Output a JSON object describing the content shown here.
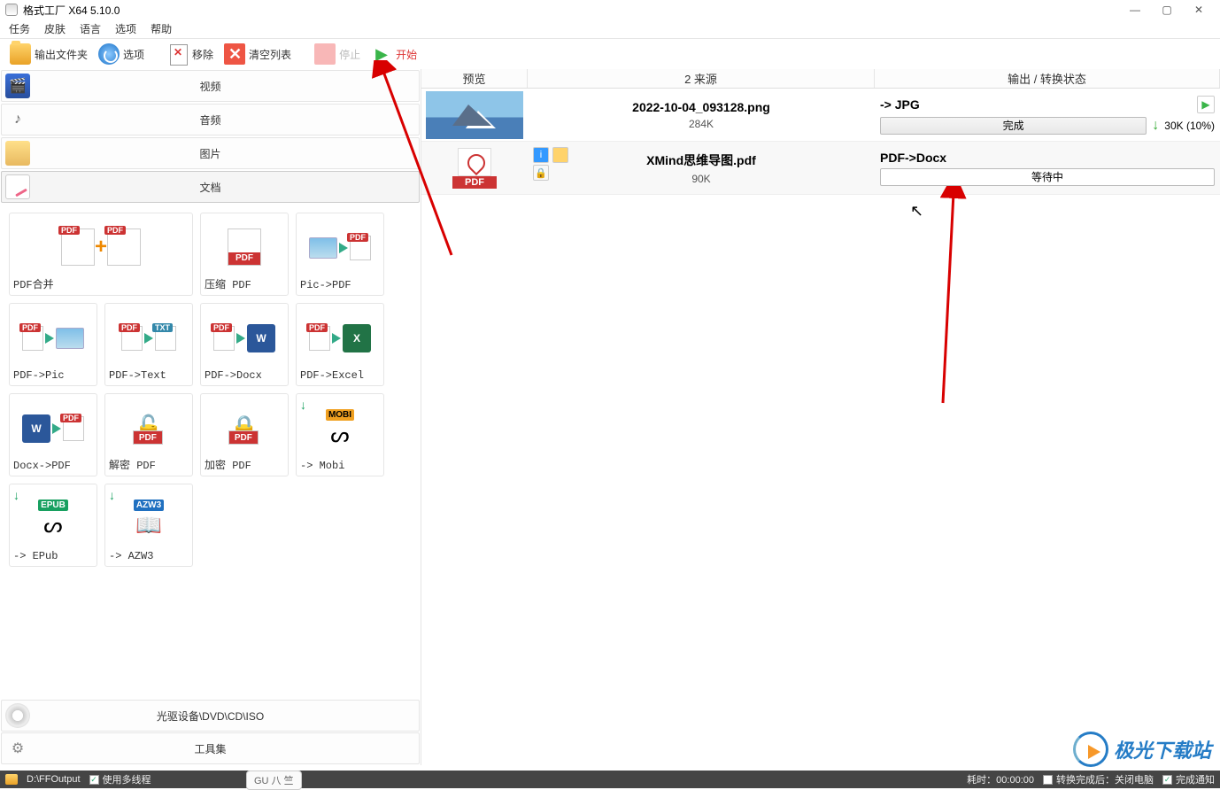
{
  "window": {
    "title": "格式工厂 X64 5.10.0"
  },
  "menu": {
    "task": "任务",
    "skin": "皮肤",
    "lang": "语言",
    "options": "选项",
    "help": "帮助"
  },
  "toolbar": {
    "output_folder": "输出文件夹",
    "options": "选项",
    "remove": "移除",
    "clear": "清空列表",
    "stop": "停止",
    "start": "开始"
  },
  "categories": {
    "video": "视频",
    "audio": "音频",
    "image": "图片",
    "doc": "文档",
    "dvd": "光驱设备\\DVD\\CD\\ISO",
    "tools": "工具集"
  },
  "grid": {
    "pdf_merge": "PDF合并",
    "compress_pdf": "压缩 PDF",
    "pic_pdf": "Pic->PDF",
    "pdf_pic": "PDF->Pic",
    "pdf_text": "PDF->Text",
    "pdf_docx": "PDF->Docx",
    "pdf_excel": "PDF->Excel",
    "docx_pdf": "Docx->PDF",
    "decrypt_pdf": "解密 PDF",
    "encrypt_pdf": "加密 PDF",
    "to_mobi": "-> Mobi",
    "to_epub": "-> EPub",
    "to_azw3": "-> AZW3",
    "tag_pdf": "PDF",
    "tag_txt": "TXT",
    "tag_mobi": "MOBI",
    "tag_epub": "EPUB",
    "tag_azw3": "AZW3"
  },
  "table": {
    "head": {
      "preview": "预览",
      "source": "2 来源",
      "status": "输出 / 转换状态"
    },
    "rows": [
      {
        "filename": "2022-10-04_093128.png",
        "size": "284K",
        "output": "-> JPG",
        "progress": "完成",
        "result": "30K  (10%)"
      },
      {
        "filename": "XMind思维导图.pdf",
        "size": "90K",
        "output": "PDF->Docx",
        "progress": "等待中",
        "result": ""
      }
    ]
  },
  "status": {
    "folder_icon_color": "#e9a227",
    "output_path": "D:\\FFOutput",
    "multithread": "使用多线程",
    "elapsed_label": "耗时：",
    "elapsed_value": "00:00:00",
    "shutdown": "转换完成后：关闭电脑",
    "notify": "完成通知",
    "ghost": "GU 八 竺"
  },
  "watermark": "极光下载站"
}
